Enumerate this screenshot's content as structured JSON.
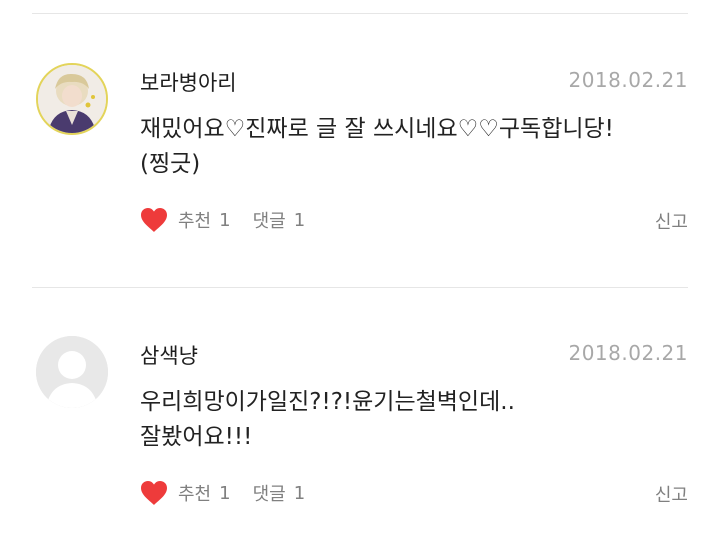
{
  "comments": [
    {
      "author": "보라병아리",
      "date": "2018.02.21",
      "lines": [
        "재밌어요♡진짜로 글 잘 쓰시네요♡♡구독합니당!",
        "(찡긋)"
      ],
      "recommend_label": "추천",
      "recommend_count": "1",
      "reply_label": "댓글",
      "reply_count": "1",
      "report_label": "신고",
      "avatar_type": "photo"
    },
    {
      "author": "삼색냥",
      "date": "2018.02.21",
      "lines": [
        "우리희망이가일진?!?!윤기는철벽인데..",
        "잘봤어요!!!"
      ],
      "recommend_label": "추천",
      "recommend_count": "1",
      "reply_label": "댓글",
      "reply_count": "1",
      "report_label": "신고",
      "avatar_type": "default"
    }
  ],
  "colors": {
    "heart": "#ee3b3b",
    "muted": "#808080",
    "date": "#a8a8a8",
    "divider": "#e6e6e6"
  },
  "icons": {
    "like": "heart-icon",
    "default_avatar": "user-silhouette-icon"
  }
}
